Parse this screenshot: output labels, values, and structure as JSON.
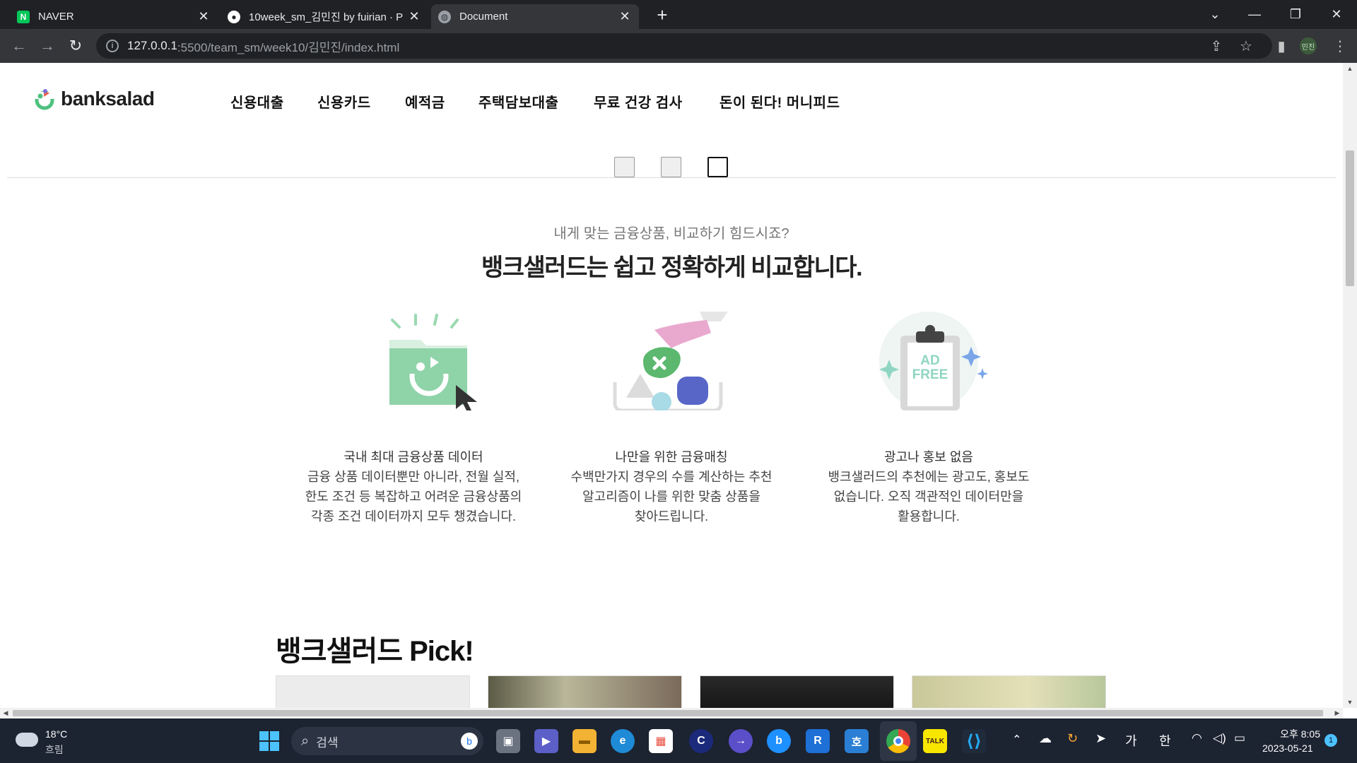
{
  "browser": {
    "tabs": [
      {
        "title": "NAVER",
        "favicon": "N",
        "favicon_color": "#03c75a",
        "active": false
      },
      {
        "title": "10week_sm_김민진 by fuirian · P",
        "favicon": "github-icon",
        "active": false
      },
      {
        "title": "Document",
        "favicon": "globe-icon",
        "active": true
      }
    ],
    "url_host": "127.0.0.1",
    "url_path": ":5500/team_sm/week10/김민진/index.html",
    "profile_label": "민진"
  },
  "site": {
    "logo_text": "banksalad",
    "nav": [
      "신용대출",
      "신용카드",
      "예적금",
      "주택담보대출",
      "무료 건강 검사",
      "돈이 된다! 머니피드"
    ],
    "slider_active_index": 2,
    "sub_headline": "내게 맞는 금융상품, 비교하기 힘드시죠?",
    "headline": "뱅크샐러드는 쉽고 정확하게 비교합니다.",
    "features": [
      {
        "title": "국내 최대 금융상품 데이터",
        "lines": [
          "금융 상품 데이터뿐만 아니라, 전월 실적,",
          "한도 조건 등 복잡하고 어려운 금융상품의",
          "각종 조건 데이터까지 모두 챙겼습니다."
        ]
      },
      {
        "title": "나만을 위한 금융매칭",
        "lines": [
          "수백만가지 경우의 수를 계산하는 추천",
          "알고리즘이 나를 위한 맞춤 상품을",
          "찾아드립니다."
        ]
      },
      {
        "title": "광고나 홍보 없음",
        "lines": [
          "뱅크샐러드의 추천에는 광고도, 홍보도",
          "없습니다. 오직 객관적인 데이터만을",
          "활용합니다."
        ],
        "badge_line1": "AD",
        "badge_line2": "FREE"
      }
    ],
    "pick_title": "뱅크샐러드 Pick!"
  },
  "taskbar": {
    "weather_temp": "18°C",
    "weather_desc": "흐림",
    "search_placeholder": "검색",
    "ime_1": "가",
    "ime_2": "한",
    "time": "오후 8:05",
    "date": "2023-05-21",
    "notification_count": "1"
  },
  "colors": {
    "brand_green": "#4ec07f",
    "chrome_dark": "#202124",
    "chrome_toolbar": "#35363a",
    "taskbar": "#1c2331"
  }
}
